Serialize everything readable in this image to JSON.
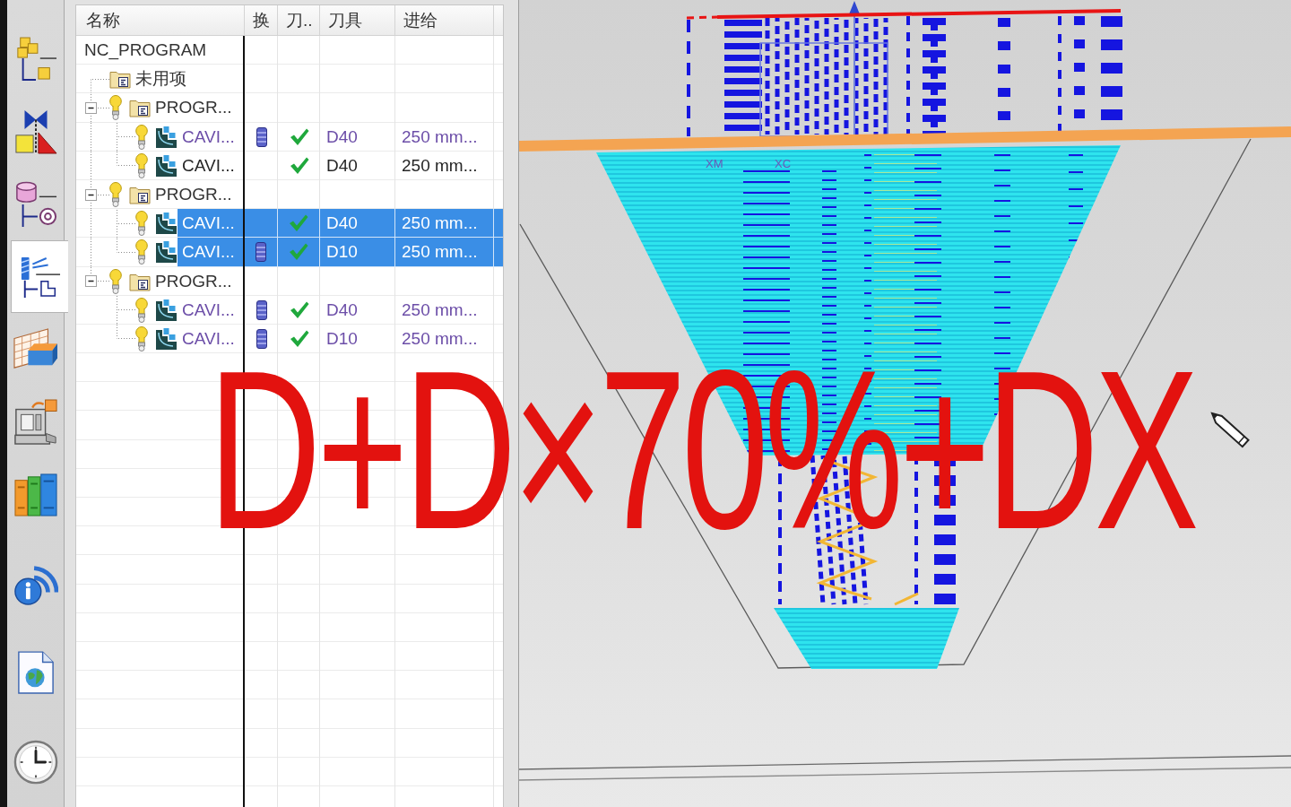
{
  "sidebar": {
    "items": [
      {
        "kind": "assembly",
        "selected": false
      },
      {
        "kind": "constraints",
        "selected": false
      },
      {
        "kind": "part",
        "selected": false
      },
      {
        "kind": "operations",
        "selected": true
      },
      {
        "kind": "reuse",
        "selected": false
      },
      {
        "kind": "machine",
        "selected": false
      },
      {
        "kind": "library",
        "selected": false
      },
      {
        "kind": "info",
        "selected": false
      },
      {
        "kind": "web",
        "selected": false
      },
      {
        "kind": "history",
        "selected": false
      }
    ]
  },
  "navigator": {
    "columns": [
      {
        "label": "名称"
      },
      {
        "label": "换"
      },
      {
        "label": "刀.."
      },
      {
        "label": "刀具"
      },
      {
        "label": "进给"
      }
    ],
    "nodes": [
      {
        "kind": "root",
        "name": "NC_PROGRAM",
        "selected": false,
        "children": [
          {
            "kind": "folder",
            "name": "未用项",
            "selected": false
          },
          {
            "kind": "program",
            "name": "PROGR...",
            "selected": false,
            "expanded": true,
            "children": [
              {
                "kind": "operation",
                "name": "CAVI...",
                "selected": false,
                "color": "#6c4ea8",
                "tool_change": true,
                "toolpath_generated": true,
                "tool": "D40",
                "feed": "250 mm..."
              },
              {
                "kind": "operation",
                "name": "CAVI...",
                "selected": false,
                "color": "#262626",
                "tool_change": false,
                "toolpath_generated": true,
                "tool": "D40",
                "feed": "250 mm..."
              }
            ]
          },
          {
            "kind": "program",
            "name": "PROGR...",
            "selected": false,
            "expanded": true,
            "children": [
              {
                "kind": "operation",
                "name": "CAVI...",
                "selected": true,
                "tool_change": false,
                "toolpath_generated": true,
                "tool": "D40",
                "feed": "250 mm..."
              },
              {
                "kind": "operation",
                "name": "CAVI...",
                "selected": true,
                "tool_change": true,
                "toolpath_generated": true,
                "tool": "D10",
                "feed": "250 mm..."
              }
            ]
          },
          {
            "kind": "program",
            "name": "PROGR...",
            "selected": false,
            "expanded": true,
            "children": [
              {
                "kind": "operation",
                "name": "CAVI...",
                "selected": false,
                "color": "#6c4ea8",
                "tool_change": true,
                "toolpath_generated": true,
                "tool": "D40",
                "feed": "250 mm..."
              },
              {
                "kind": "operation",
                "name": "CAVI...",
                "selected": false,
                "color": "#6c4ea8",
                "tool_change": true,
                "toolpath_generated": true,
                "tool": "D10",
                "feed": "250 mm..."
              }
            ]
          }
        ]
      }
    ]
  },
  "viewport": {
    "axis_labels": [
      {
        "text": "XM"
      },
      {
        "text": "XC"
      }
    ]
  },
  "annotation": {
    "text": "D+D×70%+DX"
  }
}
